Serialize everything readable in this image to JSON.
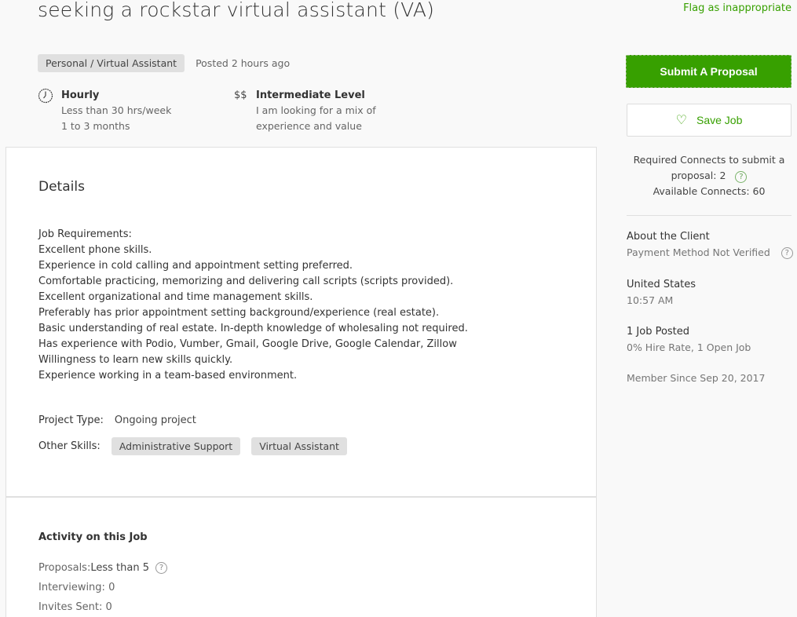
{
  "job": {
    "title": "seeking a rockstar virtual assistant (VA)",
    "flag_link": "Flag as inappropriate",
    "category": "Personal / Virtual Assistant",
    "posted": "Posted 2 hours ago",
    "features": [
      {
        "icon": "clock-icon",
        "title": "Hourly",
        "lines": [
          "Less than 30 hrs/week",
          "1 to 3 months"
        ]
      },
      {
        "icon": "dollar-icon",
        "icon_text": "$$",
        "title": "Intermediate Level",
        "lines": [
          "I am looking for a mix of",
          "experience and value"
        ]
      }
    ]
  },
  "details": {
    "heading": "Details",
    "requirements": [
      "Job Requirements:",
      "Excellent phone skills.",
      "Experience in cold calling and appointment setting preferred.",
      "Comfortable practicing, memorizing and delivering call scripts (scripts provided).",
      "Excellent organizational and time management skills.",
      "Preferably has prior appointment setting background/experience (real estate).",
      "Basic understanding of real estate. In-depth knowledge of wholesaling not required.",
      "Has experience with Podio, Vumber, Gmail, Google Drive, Google Calendar, Zillow",
      "Willingness to learn new skills quickly.",
      "Experience working in a team-based environment."
    ],
    "project_type_label": "Project Type:",
    "project_type_value": "Ongoing project",
    "other_skills_label": "Other Skills:",
    "skills": [
      "Administrative Support",
      "Virtual Assistant"
    ]
  },
  "activity": {
    "heading": "Activity on this Job",
    "proposals_label": "Proposals:",
    "proposals_value": "Less than 5",
    "interviewing": "Interviewing: 0",
    "invites_sent": "Invites Sent: 0"
  },
  "sidebar": {
    "submit_label": "Submit A Proposal",
    "save_label": "Save Job",
    "connects_line1": "Required Connects to submit a",
    "connects_line2": "proposal: 2",
    "connects_line3": "Available Connects: 60",
    "client": {
      "heading": "About the Client",
      "payment": "Payment Method Not Verified",
      "country": "United States",
      "local_time": "10:57 AM",
      "jobs_posted": "1 Job Posted",
      "hire_rate": "0% Hire Rate, 1 Open Job",
      "member_since": "Member Since Sep 20, 2017"
    }
  },
  "colors": {
    "accent": "#37a000",
    "chip_bg": "#e0e0e0",
    "page_bg": "#f9f9f9"
  }
}
